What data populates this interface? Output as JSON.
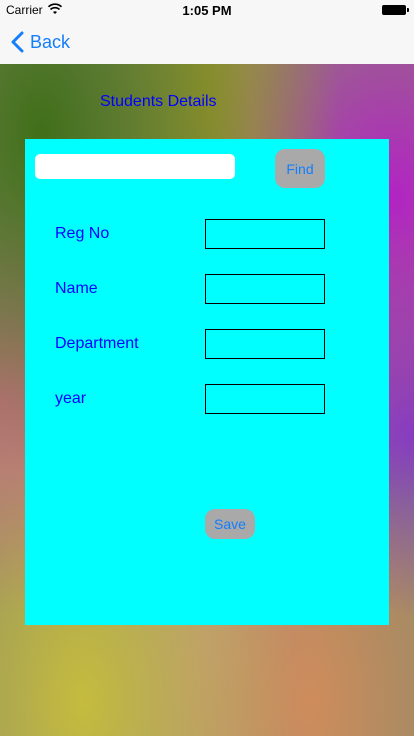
{
  "status_bar": {
    "carrier": "Carrier",
    "time": "1:05 PM"
  },
  "nav": {
    "back_label": "Back"
  },
  "page": {
    "title": "Students Details"
  },
  "search": {
    "value": "",
    "find_label": "Find"
  },
  "form": {
    "fields": [
      {
        "label": "Reg No",
        "value": ""
      },
      {
        "label": "Name",
        "value": ""
      },
      {
        "label": "Department",
        "value": ""
      },
      {
        "label": "year",
        "value": ""
      }
    ],
    "save_label": "Save"
  },
  "colors": {
    "panel": "#00ffff",
    "label_text": "#0000ff",
    "button_bg": "#a9a9a9",
    "button_text": "#147efb"
  }
}
